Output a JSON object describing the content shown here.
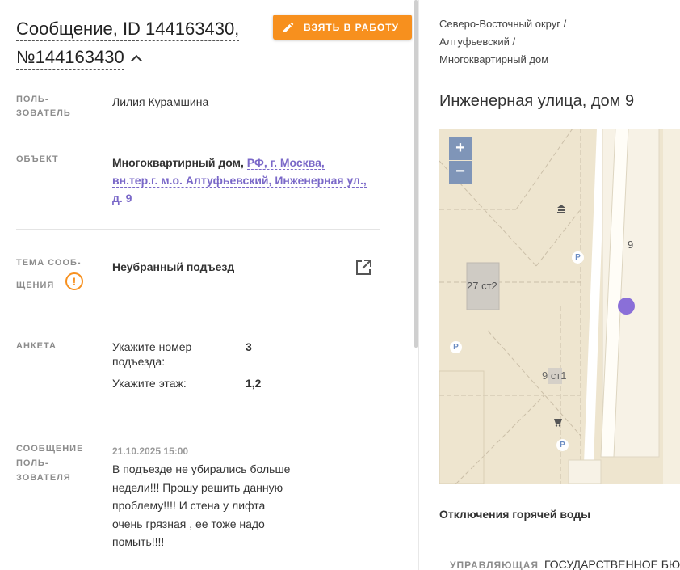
{
  "message": {
    "title_line1": "Сообщение, ID 144163430,",
    "title_line2": "№144163430",
    "take_button_label": "ВЗЯТЬ В РАБОТУ"
  },
  "fields": {
    "user_label_1": "ПОЛЬ-",
    "user_label_2": "ЗОВАТЕЛЬ",
    "user_value": "Лилия Курамшина",
    "object_label": "ОБЪЕКТ",
    "object_type": "Многоквартирный дом,",
    "object_addr_1": "РФ, г. Москва,",
    "object_addr_2": "вн.тер.г. м.о. Алтуфьевский, Инженерная ул.,",
    "object_addr_3": "д. 9",
    "topic_label_1": "ТЕМА СООБ-",
    "topic_label_2": "ЩЕНИЯ",
    "topic_value": "Неубранный подъезд",
    "survey_label": "АНКЕТА",
    "survey_q1": "Укажите номер подъезда:",
    "survey_a1": "3",
    "survey_q2": "Укажите этаж:",
    "survey_a2": "1,2",
    "msg_label_1": "СООБЩЕНИЕ",
    "msg_label_2": "ПОЛЬ-",
    "msg_label_3": "ЗОВАТЕЛЯ",
    "msg_date": "21.10.2025 15:00",
    "msg_text_1": "В подъезде не убирались больше",
    "msg_text_2": "недели!!! Прошу решить данную",
    "msg_text_3": "проблему!!!! И стена у лифта",
    "msg_text_4": "очень грязная , ее тоже надо",
    "msg_text_5": "помыть!!!!"
  },
  "right": {
    "crumb_1": "Северо-Восточный округ /",
    "crumb_2": "Алтуфьевский /",
    "crumb_3": "Многоквартирный дом",
    "address": "Инженерная улица, дом 9",
    "map": {
      "zoom_in": "+",
      "zoom_out": "−",
      "label_building": "27 ст2",
      "label_house": "9",
      "label_st1": "9 ст1",
      "parking": "P"
    },
    "outage_title": "Отключения горячей воды",
    "mgmt_label": "УПРАВЛЯЮЩАЯ",
    "mgmt_value": "ГОСУДАРСТВЕННОЕ БЮ"
  },
  "colors": {
    "accent": "#f7901e",
    "link": "#7a68c8",
    "map_bg": "#eee5cf",
    "marker": "#8a6fd8"
  }
}
